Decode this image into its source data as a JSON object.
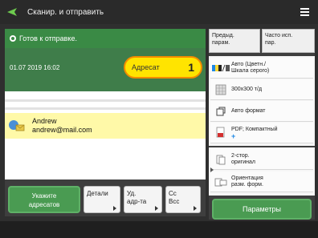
{
  "header": {
    "title": "Сканир. и отправить",
    "menu_icon": "hamburger-icon"
  },
  "status": {
    "text": "Готов к отправке.",
    "datetime": "01.07 2019 16:02"
  },
  "addressee": {
    "label": "Адресат",
    "count": "1"
  },
  "list": {
    "items": [
      {
        "name": "Andrew",
        "email": "andrew@mail.com"
      }
    ]
  },
  "bottom_buttons": {
    "specify_line1": "Укажите",
    "specify_line2": "адресатов",
    "details": "Детали",
    "delete_line1": "Уд.",
    "delete_line2": "адр-та",
    "cc_line1": "Cc",
    "cc_line2": "Bcc"
  },
  "tabs": {
    "recent_line1": "Предыд.",
    "recent_line2": "парам.",
    "frequent_line1": "Часто исп.",
    "frequent_line2": "пар."
  },
  "options": {
    "color_line1": "Авто (Цветн./",
    "color_line2": "Шкала серого)",
    "resolution": "300x300 т/д",
    "size": "Авто формат",
    "format_line1": "PDF; Компактный",
    "duplex_line1": "2-стор.",
    "duplex_line2": "оригинал",
    "orient_line1": "Ориентация",
    "orient_line2": "разм. форм."
  },
  "params_button": "Параметры",
  "colors": {
    "accent_green": "#4a9b52",
    "highlight": "#ffe400",
    "selected_row": "#fff9a8"
  }
}
